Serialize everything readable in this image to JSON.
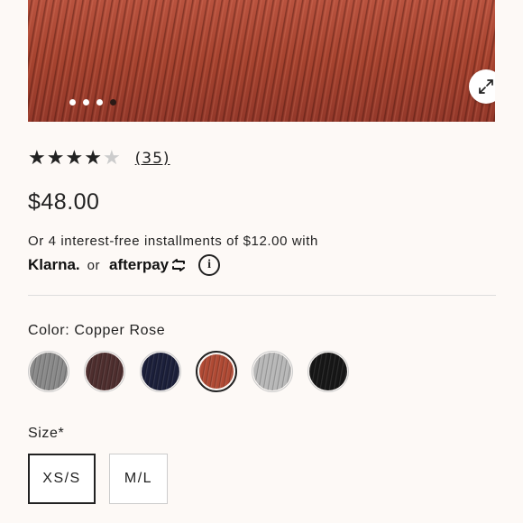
{
  "gallery": {
    "dot_count": 4,
    "active_dot": 4,
    "expand_icon": "expand-arrows-icon"
  },
  "rating": {
    "stars": 4.5,
    "review_count": "(35)"
  },
  "price": "$48.00",
  "installments": {
    "text": "Or 4 interest-free installments of $12.00 with",
    "klarna": "Klarna.",
    "or": "or",
    "afterpay": "afterpay"
  },
  "color": {
    "label": "Color: Copper Rose",
    "swatches": [
      {
        "color": "#8a8a8a",
        "selected": false
      },
      {
        "color": "#4e2e2e",
        "selected": false
      },
      {
        "color": "#1b1f3a",
        "selected": false
      },
      {
        "color": "#b04a34",
        "selected": true
      },
      {
        "color": "#b8b8b8",
        "selected": false
      },
      {
        "color": "#161616",
        "selected": false
      }
    ]
  },
  "size": {
    "label": "Size*",
    "options": [
      {
        "label": "XS/S",
        "selected": true
      },
      {
        "label": "M/L",
        "selected": false
      }
    ]
  }
}
